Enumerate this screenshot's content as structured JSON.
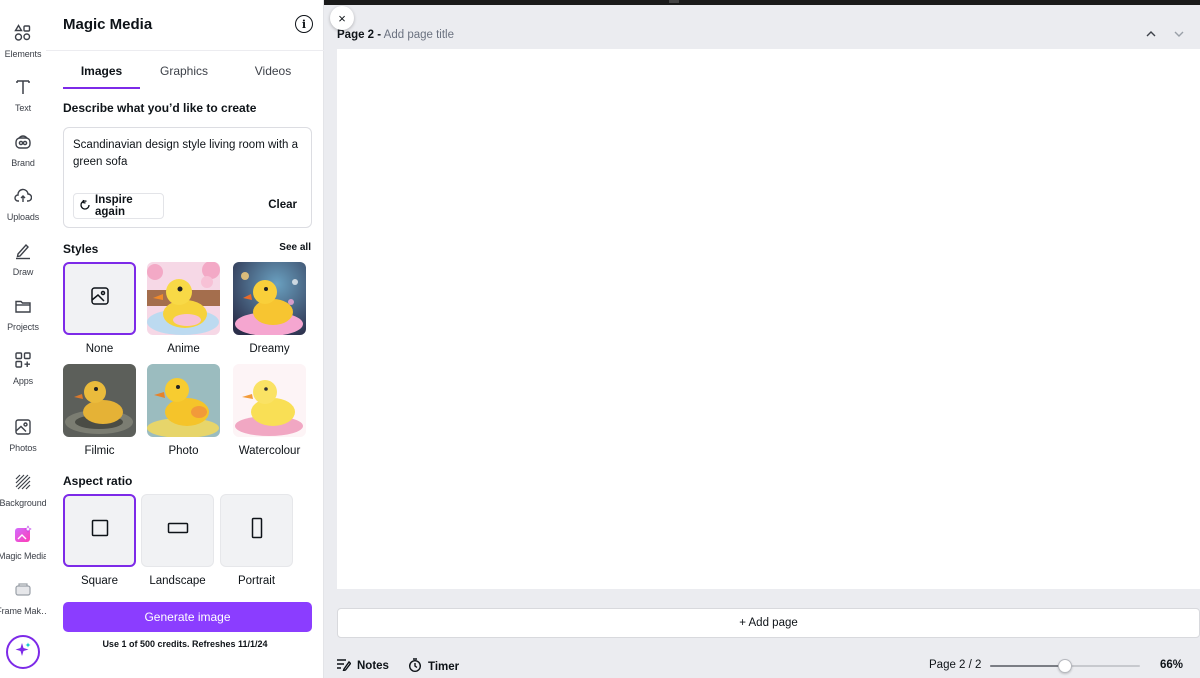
{
  "rail": {
    "items": [
      {
        "label": "Elements",
        "icon": "elements-icon"
      },
      {
        "label": "Text",
        "icon": "text-icon"
      },
      {
        "label": "Brand",
        "icon": "brand-icon"
      },
      {
        "label": "Uploads",
        "icon": "uploads-icon"
      },
      {
        "label": "Draw",
        "icon": "draw-icon"
      },
      {
        "label": "Projects",
        "icon": "projects-icon"
      },
      {
        "label": "Apps",
        "icon": "apps-icon"
      },
      {
        "label": "Photos",
        "icon": "photos-icon"
      },
      {
        "label": "Background",
        "icon": "background-icon"
      },
      {
        "label": "Magic Media",
        "icon": "magic-media-icon"
      },
      {
        "label": "Frame Mak…",
        "icon": "frame-maker-icon"
      }
    ],
    "active": "Magic Media"
  },
  "panel": {
    "title": "Magic Media",
    "info_icon": "i",
    "tabs": [
      {
        "label": "Images",
        "active": true
      },
      {
        "label": "Graphics",
        "active": false
      },
      {
        "label": "Videos",
        "active": false
      }
    ],
    "describe_label": "Describe what you’d like to create",
    "prompt": "Scandinavian design style living room with a green sofa",
    "inspire_label": "Inspire again",
    "clear_label": "Clear",
    "styles_label": "Styles",
    "see_all_label": "See all",
    "styles": [
      {
        "label": "None",
        "selected": true
      },
      {
        "label": "Anime",
        "selected": false
      },
      {
        "label": "Dreamy",
        "selected": false
      },
      {
        "label": "Filmic",
        "selected": false
      },
      {
        "label": "Photo",
        "selected": false
      },
      {
        "label": "Watercolour",
        "selected": false
      }
    ],
    "aspect_label": "Aspect ratio",
    "aspects": [
      {
        "label": "Square",
        "selected": true
      },
      {
        "label": "Landscape",
        "selected": false
      },
      {
        "label": "Portrait",
        "selected": false
      }
    ],
    "generate_label": "Generate image",
    "credits_text": "Use 1 of 500 credits. Refreshes 11/1/24"
  },
  "canvas": {
    "close_icon": "×",
    "page_label": "Page 2 -",
    "page_title_placeholder": "Add page title",
    "add_page_label": "+ Add page"
  },
  "bottom": {
    "notes_label": "Notes",
    "timer_label": "Timer",
    "page_count": "Page 2 / 2",
    "zoom_label": "66%",
    "zoom_level": 0.5
  },
  "colors": {
    "accent": "#7d2ae8",
    "generate": "#8b3dff"
  }
}
